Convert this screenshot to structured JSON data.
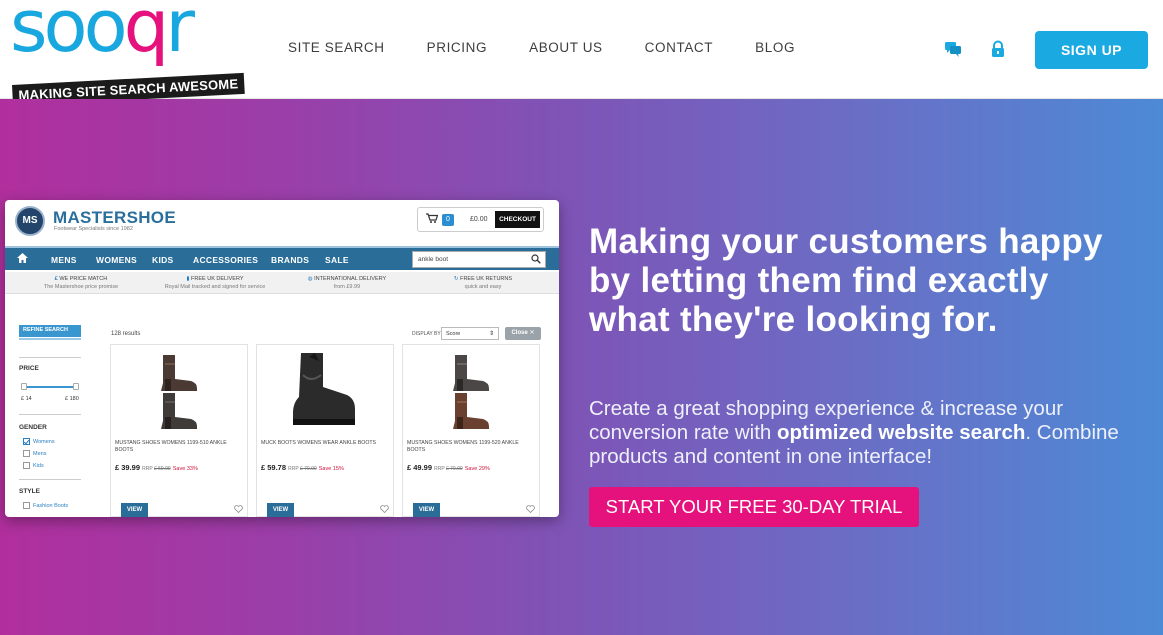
{
  "brand": {
    "name": "sooqr",
    "tagline": "MAKING SITE SEARCH AWESOME",
    "blue": "#19a7e0",
    "pink": "#e5127d"
  },
  "nav": {
    "items": [
      "SITE SEARCH",
      "PRICING",
      "ABOUT US",
      "CONTACT",
      "BLOG"
    ],
    "icons": [
      "chat-icon",
      "lock-icon"
    ],
    "signup_label": "SIGN UP"
  },
  "hero": {
    "title": "Making your customers happy by letting them find exactly what they're looking for.",
    "desc_before": "Create a great shopping experience & increase your conversion rate with ",
    "desc_bold": "optimized website search",
    "desc_after": ". Combine products and content in one interface!",
    "cta_label": "START YOUR FREE 30-DAY TRIAL",
    "gradient": [
      "#b02f9d",
      "#7d55b7",
      "#4d8ad6"
    ]
  },
  "demo": {
    "store_name": "MASTERSHOE",
    "store_logo_text": "MS",
    "store_tagline": "Footwear Specialists since 1982",
    "cart_count": "0",
    "cart_total": "£0.00",
    "checkout_label": "CHECKOUT",
    "menu": [
      "MENS",
      "WOMENS",
      "KIDS",
      "ACCESSORIES",
      "BRANDS",
      "SALE"
    ],
    "search_value": "ankle boot",
    "usps": [
      {
        "title": "WE PRICE MATCH",
        "sub": "The Mastershoe price promise"
      },
      {
        "title": "FREE UK DELIVERY",
        "sub": "Royal Mail tracked and signed for service"
      },
      {
        "title": "INTERNATIONAL DELIVERY",
        "sub": "from £9.99"
      },
      {
        "title": "FREE UK RETURNS",
        "sub": "quick and easy"
      }
    ],
    "refine_label": "REFINE SEARCH",
    "price_facet": "PRICE",
    "price_min": "£ 14",
    "price_max": "£ 180",
    "gender_facet": "GENDER",
    "gender_options": [
      {
        "label": "Womens",
        "checked": true
      },
      {
        "label": "Mens",
        "checked": false
      },
      {
        "label": "Kids",
        "checked": false
      }
    ],
    "style_facet": "STYLE",
    "style_options": [
      {
        "label": "Fashion Boots",
        "checked": false
      }
    ],
    "results_count": "128 results",
    "display_by_label": "DISPLAY BY",
    "sort_value": "Score",
    "close_label": "Close",
    "products": [
      {
        "name": "MUSTANG SHOES WOMENS 1199-510 ANKLE BOOTS",
        "price": "£ 39.99",
        "rrp_label": "RRP",
        "rrp": "£ 59.99",
        "save": "Save 33%",
        "view_label": "VIEW"
      },
      {
        "name": "MUCK BOOTS WOMENS WEAR ANKLE BOOTS",
        "price": "£ 59.78",
        "rrp_label": "RRP",
        "rrp": "£ 70.00",
        "save": "Save 15%",
        "view_label": "VIEW"
      },
      {
        "name": "MUSTANG SHOES WOMENS 1199-520 ANKLE BOOTS",
        "price": "£ 49.99",
        "rrp_label": "RRP",
        "rrp": "£ 70.00",
        "save": "Save 29%",
        "view_label": "VIEW"
      }
    ]
  }
}
